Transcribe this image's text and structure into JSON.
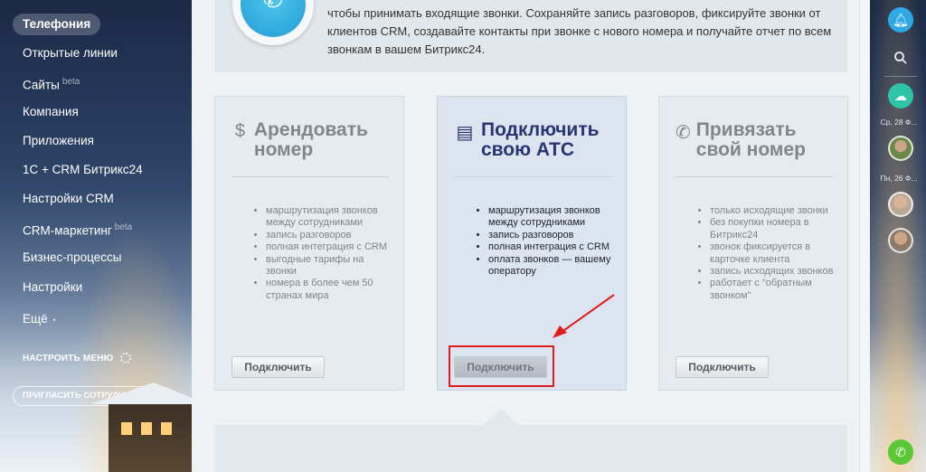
{
  "sidebar": {
    "items": [
      {
        "label": "Телефония",
        "active": true,
        "beta": ""
      },
      {
        "label": "Открытые линии",
        "beta": ""
      },
      {
        "label": "Сайты",
        "beta": "beta"
      },
      {
        "label": "Компания",
        "beta": ""
      },
      {
        "label": "Приложения",
        "beta": ""
      },
      {
        "label": "1С + CRM Битрикс24",
        "beta": ""
      },
      {
        "label": "Настройки CRM",
        "beta": ""
      },
      {
        "label": "CRM-маркетинг",
        "beta": "beta"
      },
      {
        "label": "Бизнес-процессы",
        "beta": ""
      },
      {
        "label": "Настройки",
        "beta": ""
      },
      {
        "label": "Ещё",
        "beta": ""
      }
    ],
    "more_suffix": "•",
    "settings_label": "НАСТРОИТЬ МЕНЮ",
    "invite_label": "ПРИГЛАСИТЬ СОТРУДНИКОВ",
    "invite_plus": "+"
  },
  "info": {
    "text": "чтобы принимать входящие звонки. Сохраняйте запись разговоров, фиксируйте звонки от клиентов CRM, создавайте контакты при звонке с нового номера и получайте отчет по всем звонкам в вашем Битрикс24."
  },
  "cards": [
    {
      "title": "Арендовать номер",
      "icon": "$",
      "items": [
        "маршрутизация звонков между сотрудниками",
        "запись разговоров",
        "полная интеграция с CRM",
        "выгодные тарифы на звонки",
        "номера в более чем 50 странах мира"
      ],
      "button": "Подключить"
    },
    {
      "title": "Подключить свою АТС",
      "icon": "▤",
      "items": [
        "маршрутизация звонков между сотрудниками",
        "запись разговоров",
        "полная интеграция с CRM",
        "оплата звонков — вашему оператору"
      ],
      "button": "Подключить"
    },
    {
      "title": "Привязать свой номер",
      "icon": "✆",
      "items": [
        "только исходящие звонки",
        "без покупки номера в Битрикс24",
        "звонок фиксируется в карточке клиента",
        "запись исходящих звонков",
        "работает с \"обратным звонком\""
      ],
      "button": "Подключить"
    }
  ],
  "right_panel": {
    "date1": "Ср, 28 Ф...",
    "date2": "Пн, 26 Ф...",
    "icons": [
      "bell-icon",
      "search-icon",
      "cloud-icon",
      "phone-icon"
    ]
  },
  "colors": {
    "accent": "#2fa9e6",
    "highlight": "#e01d1d",
    "featured_title": "#283573",
    "call": "#5ac735"
  }
}
